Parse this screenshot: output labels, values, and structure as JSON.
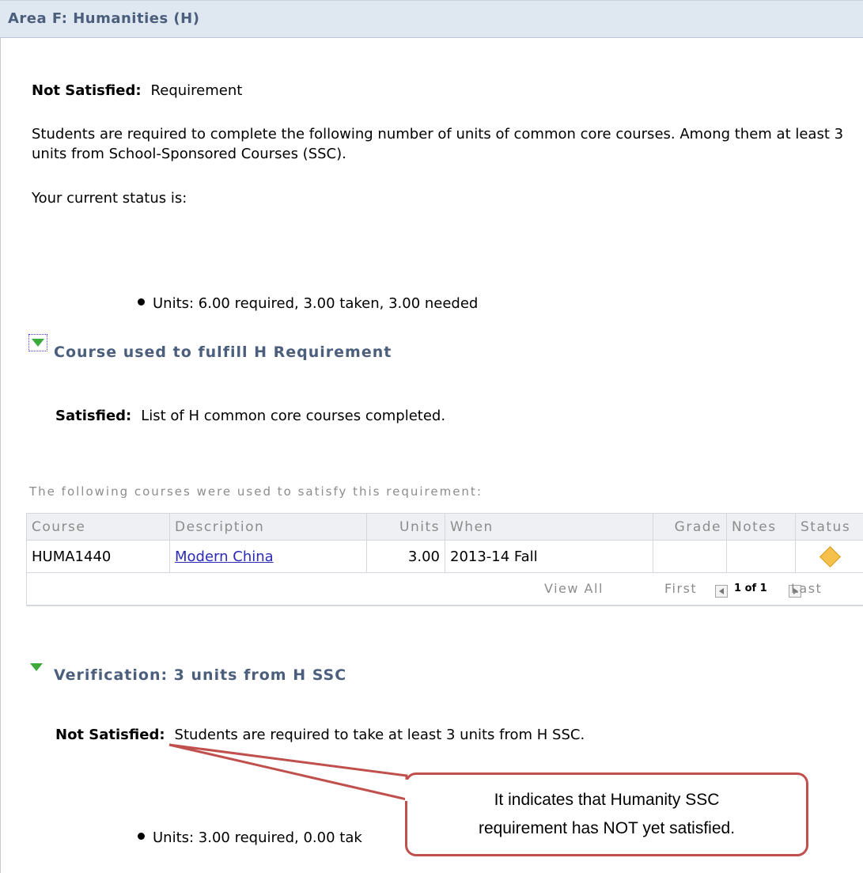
{
  "area": {
    "title": "Area F: Humanities (H)"
  },
  "requirement": {
    "status_label": "Not Satisfied:",
    "status_text": "Requirement",
    "description": "Students are required to complete the following number of units of common core courses. Among them at least 3 units from School-Sponsored Courses (SSC).",
    "current_status": "Your current status is:",
    "units": "Units: 6.00 required, 3.00 taken, 3.00 needed"
  },
  "course_section": {
    "title": "Course used to fulfill H Requirement",
    "status_label": "Satisfied:",
    "status_text": "List of H common core courses completed.",
    "caption": "The following courses were used to satisfy this requirement:",
    "columns": [
      "Course",
      "Description",
      "Units",
      "When",
      "Grade",
      "Notes",
      "Status"
    ],
    "rows": [
      {
        "course": "HUMA1440",
        "description": "Modern China",
        "units": "3.00",
        "when": "2013-14 Fall",
        "grade": "",
        "notes": "",
        "status_icon": "diamond-icon"
      }
    ],
    "nav": {
      "view_all": "View All",
      "first": "First",
      "page": "1 of 1",
      "last": "Last"
    }
  },
  "verification": {
    "title": "Verification: 3 units from H SSC",
    "status_label": "Not Satisfied:",
    "status_text": "Students are required to take at least 3 units from H SSC.",
    "units": "Units: 3.00 required, 0.00 tak"
  },
  "callout": {
    "text_line1": "It indicates that Humanity SSC",
    "text_line2": "requirement has NOT yet satisfied.",
    "color": "#c0504d"
  }
}
